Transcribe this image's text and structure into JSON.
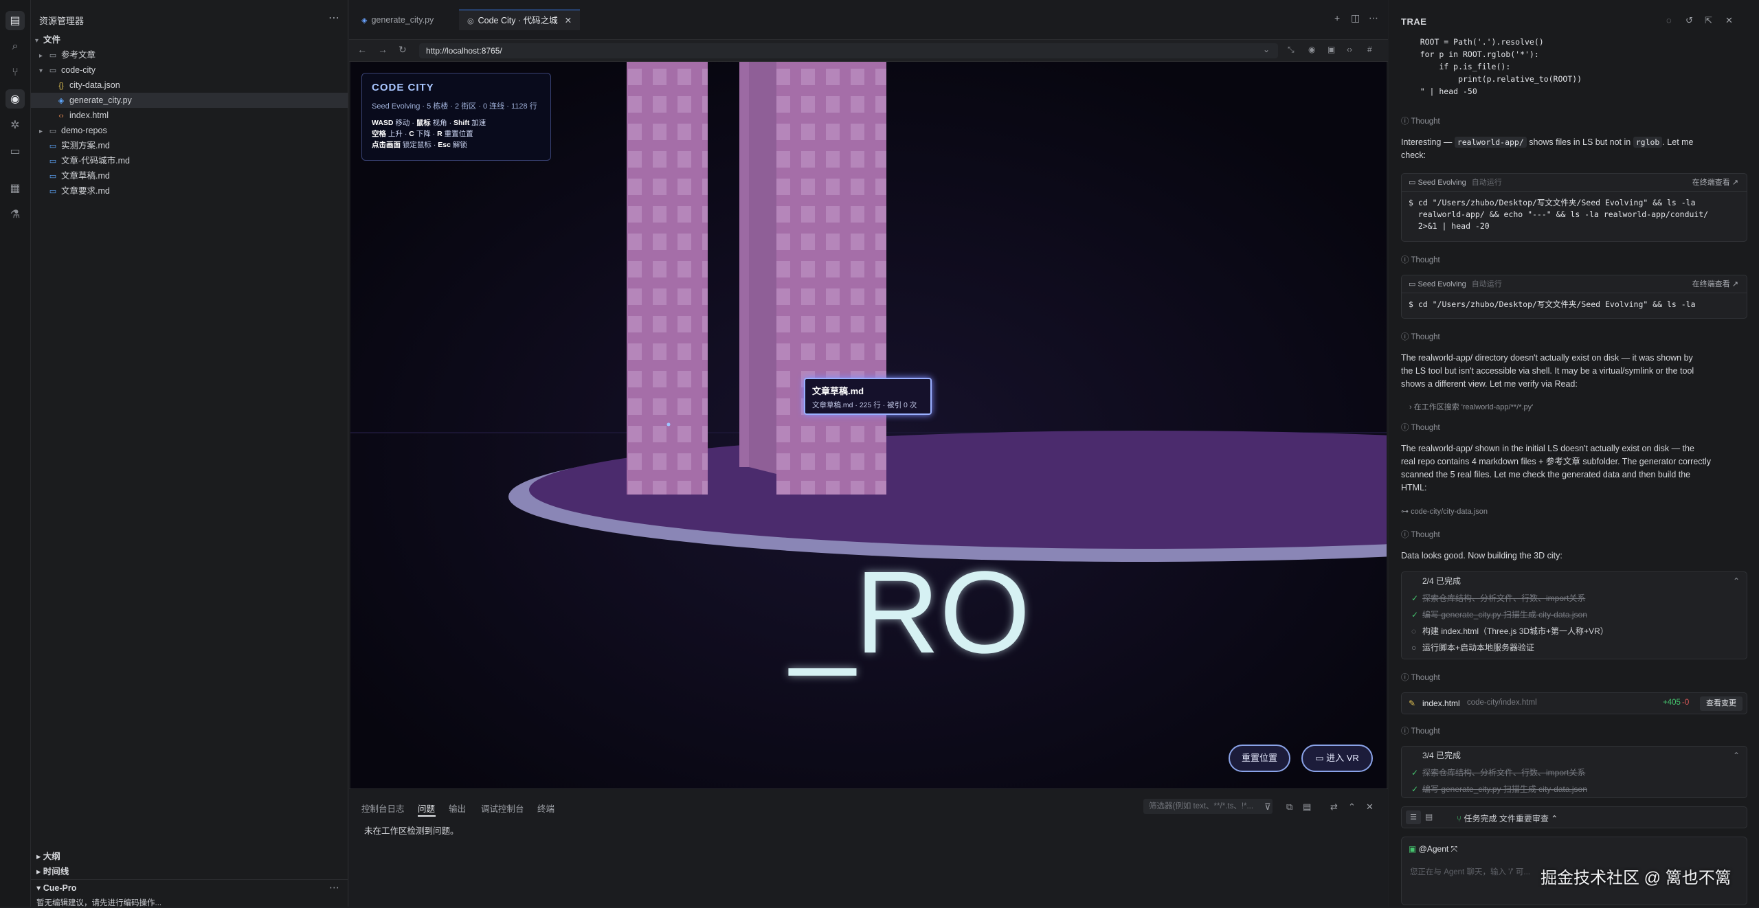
{
  "activity": {
    "icons": [
      "files-icon",
      "search-icon",
      "source-control-icon",
      "preview-icon",
      "debug-icon",
      "remote-icon",
      "extensions-icon",
      "test-icon"
    ]
  },
  "explorer": {
    "title": "资源管理器",
    "root": "文件",
    "items": [
      {
        "label": "参考文章",
        "type": "folder"
      },
      {
        "label": "code-city",
        "type": "folder-open"
      },
      {
        "label": "city-data.json",
        "type": "json"
      },
      {
        "label": "generate_city.py",
        "type": "py"
      },
      {
        "label": "index.html",
        "type": "html"
      },
      {
        "label": "demo-repos",
        "type": "folder"
      },
      {
        "label": "实测方案.md",
        "type": "md"
      },
      {
        "label": "文章-代码城市.md",
        "type": "md"
      },
      {
        "label": "文章草稿.md",
        "type": "md"
      },
      {
        "label": "文章要求.md",
        "type": "md"
      }
    ],
    "outline": "大纲",
    "timeline": "时间线",
    "cue_title": "Cue-Pro",
    "cue_msg": "暂无编辑建议，请先进行编码操作..."
  },
  "tabs": [
    {
      "label": "generate_city.py"
    },
    {
      "label": "Code City · 代码之城"
    }
  ],
  "browser": {
    "url": "http://localhost:8765/"
  },
  "scene": {
    "hud_title": "CODE CITY",
    "hud_stats": "Seed Evolving · 5 栋楼 · 2 街区 · 0 连线 · 1128 行",
    "ctl1_k1": "WASD",
    "ctl1_t1": " 移动 · ",
    "ctl1_k2": "鼠标",
    "ctl1_t2": " 视角 · ",
    "ctl1_k3": "Shift",
    "ctl1_t3": " 加速",
    "ctl2_k1": "空格",
    "ctl2_t1": " 上升 · ",
    "ctl2_k2": "C",
    "ctl2_t2": " 下降 · ",
    "ctl2_k3": "R",
    "ctl2_t3": " 重置位置",
    "ctl3_k1": "点击画面",
    "ctl3_t1": " 锁定鼠标 · ",
    "ctl3_k2": "Esc",
    "ctl3_t2": " 解锁",
    "tooltip_title": "文章草稿.md",
    "tooltip_sub": "文章草稿.md · 225 行 · 被引 0 次",
    "ground_text": "_RO",
    "reset_btn": "重置位置",
    "vr_btn": "进入 VR"
  },
  "panel": {
    "tabs": [
      "控制台日志",
      "问题",
      "输出",
      "调试控制台",
      "终端"
    ],
    "active": 1,
    "filter_placeholder": "筛选器(例如 text、**/*.ts、!*...",
    "message": "未在工作区检测到问题。"
  },
  "chat": {
    "title": "TRAE",
    "code_top": "    ROOT = Path('.').resolve()\n    for p in ROOT.rglob('*'):\n        if p.is_file():\n            print(p.relative_to(ROOT))\n    \" | head -50",
    "thought": "Thought",
    "m1a": "Interesting — ",
    "m1code": "realworld-app/",
    "m1b": " shows files in LS but not in ",
    "m1code2": "rglob",
    "m1c": ". Let me",
    "m1d": "check:",
    "term1_name": "Seed Evolving",
    "term1_mode": "自动运行",
    "term_open": "在终端查看",
    "term1_cmd": "$ cd \"/Users/zhubo/Desktop/写文文件夹/Seed Evolving\" && ls -la\n  realworld-app/ && echo \"---\" && ls -la realworld-app/conduit/\n  2>&1 | head -20",
    "term2_cmd": "$ cd \"/Users/zhubo/Desktop/写文文件夹/Seed Evolving\" && ls -la",
    "m2": [
      "The realworld-app/ directory doesn't actually exist on disk — it was shown by",
      "the LS tool but isn't accessible via shell. It may be a virtual/symlink or the tool",
      "shows a different view. Let me verify via Read:"
    ],
    "search": "在工作区搜索 'realworld-app/**/*.py'",
    "m3": [
      "The realworld-app/ shown in the initial LS doesn't actually exist on disk — the",
      "real repo contains 4 markdown files + 参考文章 subfolder. The generator correctly",
      "scanned the 5 real files. Let me check the generated data and then build the",
      "HTML:"
    ],
    "file_ref": "code-city/city-data.json",
    "m4": "Data looks good. Now building the 3D city:",
    "todo1_head": "2/4 已完成",
    "todo_items": [
      "探索仓库结构、分析文件、行数、import关系",
      "编写 generate_city.py 扫描生成 city-data.json",
      "构建 index.html（Three.js 3D城市+第一人称+VR）",
      "运行脚本+启动本地服务器验证"
    ],
    "file_change_name": "index.html",
    "file_change_path": "code-city/index.html",
    "file_change_add": "+405",
    "file_change_del": "-0",
    "file_change_btn": "查看变更",
    "todo2_head": "3/4 已完成",
    "task_status": "任务完成",
    "task_link": "文件重要审查",
    "agent": "@Agent",
    "input_placeholder": "您正在与 Agent 聊天，输入 '/' 可..."
  },
  "watermark": "掘金技术社区 @ 篱也不篱"
}
